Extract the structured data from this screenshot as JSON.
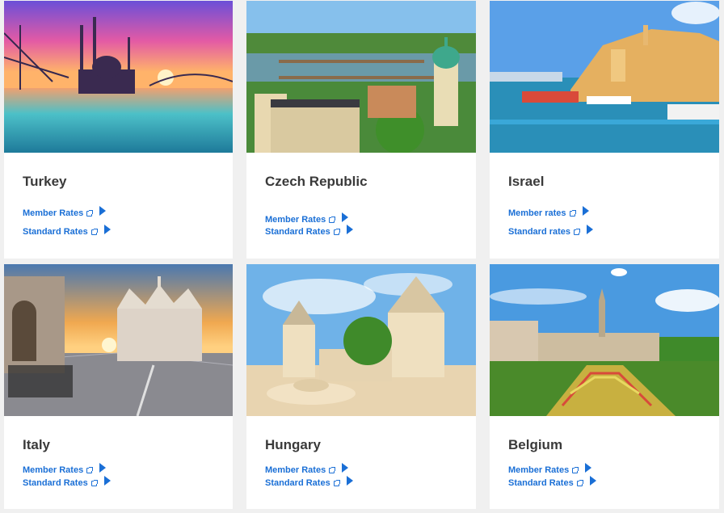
{
  "colors": {
    "link": "#1a6fd6",
    "title": "#3a3a3a",
    "card": "#ffffff",
    "background": "#f0f0f0"
  },
  "cards": [
    {
      "country": "Turkey",
      "member_label": "Member Rates",
      "standard_label": "Standard Rates"
    },
    {
      "country": "Czech Republic",
      "member_label": "Member Rates",
      "standard_label": "Standard Rates"
    },
    {
      "country": "Israel",
      "member_label": "Member rates",
      "standard_label": "Standard rates"
    },
    {
      "country": "Italy",
      "member_label": "Member Rates",
      "standard_label": "Standard Rates"
    },
    {
      "country": "Hungary",
      "member_label": "Member Rates",
      "standard_label": "Standard Rates"
    },
    {
      "country": "Belgium",
      "member_label": "Member Rates",
      "standard_label": "Standard Rates"
    }
  ]
}
